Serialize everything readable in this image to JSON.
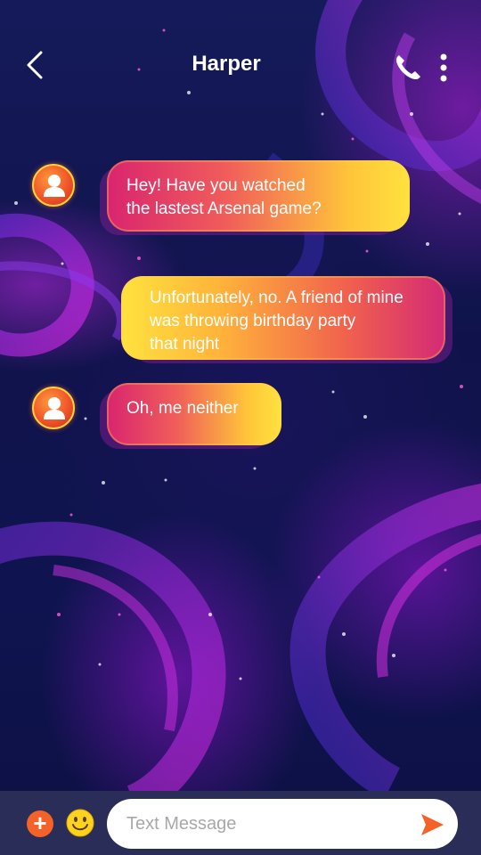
{
  "header": {
    "title": "Harper",
    "back_icon": "chevron-left-icon",
    "call_icon": "phone-icon",
    "more_icon": "more-vertical-icon"
  },
  "messages": [
    {
      "direction": "incoming",
      "text": "Hey! Have you watched\nthe lastest Arsenal game?"
    },
    {
      "direction": "outgoing",
      "text": "Unfortunately, no. A friend of mine\nwas throwing birthday party\nthat night"
    },
    {
      "direction": "incoming",
      "text": "Oh, me neither"
    }
  ],
  "composer": {
    "placeholder": "Text Message",
    "value": "",
    "add_icon": "plus-icon",
    "emoji_icon": "smiley-icon",
    "send_icon": "send-icon",
    "add_label": "+"
  },
  "colors": {
    "accent": "#f4622a",
    "bubble_yellow": "#ffe23e",
    "bubble_pink": "#d9246f",
    "composer_bg": "#2a2d57"
  }
}
